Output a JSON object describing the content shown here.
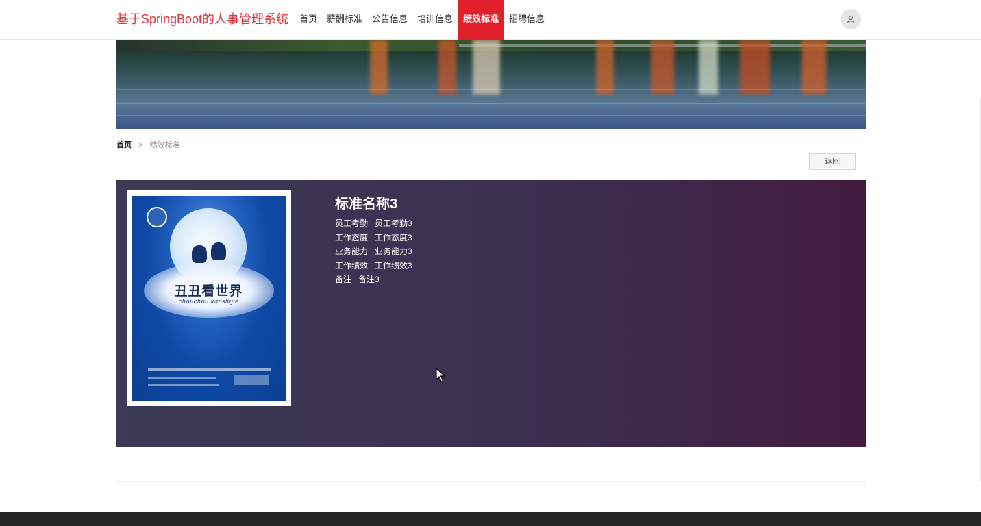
{
  "brand": "基于SpringBoot的人事管理系统",
  "nav": [
    {
      "label": "首页",
      "active": false
    },
    {
      "label": "薪酬标准",
      "active": false
    },
    {
      "label": "公告信息",
      "active": false
    },
    {
      "label": "培训信息",
      "active": false
    },
    {
      "label": "绩效标准",
      "active": true
    },
    {
      "label": "招聘信息",
      "active": false
    }
  ],
  "user_icon": "user-icon",
  "breadcrumb": {
    "home": "首页",
    "separator": ">",
    "current": "绩效标准"
  },
  "back_label": "返回",
  "detail": {
    "title": "标准名称3",
    "rows": [
      {
        "label": "员工考勤",
        "value": "员工考勤3"
      },
      {
        "label": "工作态度",
        "value": "工作态度3"
      },
      {
        "label": "业务能力",
        "value": "业务能力3"
      },
      {
        "label": "工作绩效",
        "value": "工作绩效3"
      },
      {
        "label": "备注",
        "value": "备注3"
      }
    ],
    "poster": {
      "title": "丑丑看世界",
      "subtitle": "chouchou kanshijie"
    }
  },
  "colors": {
    "accent": "#e0202b",
    "brand": "#d9363e",
    "panel_start": "#3b3b55",
    "panel_end": "#431c40",
    "footer": "#262626"
  }
}
